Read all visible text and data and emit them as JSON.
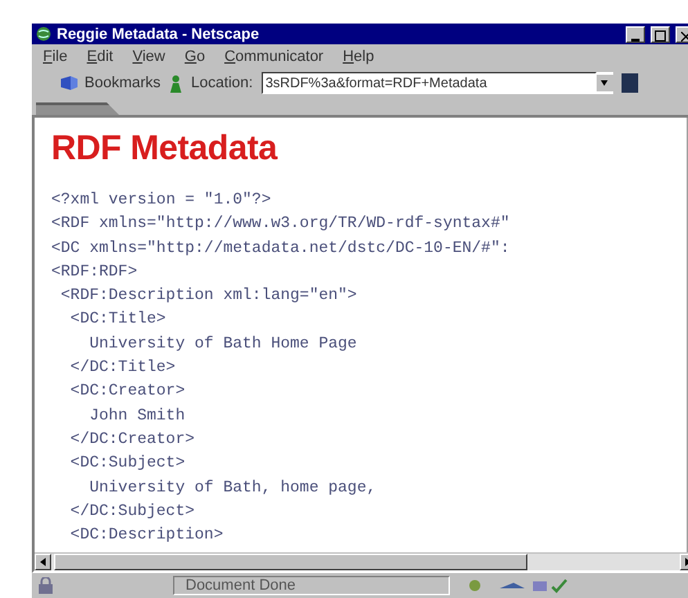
{
  "window": {
    "title": "Reggie Metadata - Netscape"
  },
  "menu": [
    "File",
    "Edit",
    "View",
    "Go",
    "Communicator",
    "Help"
  ],
  "toolbar": {
    "bookmarks": "Bookmarks",
    "location_label": "Location:",
    "location_value": "3sRDF%3a&format=RDF+Metadata"
  },
  "page": {
    "heading": "RDF Metadata",
    "code": [
      {
        "text": "<?xml version = \"1.0\"?>"
      },
      {
        "text": "<RDF xmlns=\"http://www.w3.org/TR/WD-rdf-syntax#\""
      },
      {
        "text": "<DC xmlns=\"http://metadata.net/dstc/DC-10-EN/#\":"
      },
      {
        "text": "<RDF:RDF>",
        "children": [
          {
            "text": "<RDF:Description xml:lang=\"en\">",
            "children": [
              {
                "text": "<DC:Title>",
                "children": [
                  {
                    "text": "University of Bath Home Page"
                  }
                ]
              },
              {
                "text": "</DC:Title>"
              },
              {
                "text": "<DC:Creator>",
                "children": [
                  {
                    "text": "John Smith"
                  }
                ]
              },
              {
                "text": "</DC:Creator>"
              },
              {
                "text": "<DC:Subject>",
                "children": [
                  {
                    "text": "University of Bath, home page,"
                  }
                ]
              },
              {
                "text": "</DC:Subject>"
              },
              {
                "text": "<DC:Description>"
              }
            ]
          }
        ]
      }
    ]
  },
  "status_bar": {
    "text": "Document Done"
  }
}
